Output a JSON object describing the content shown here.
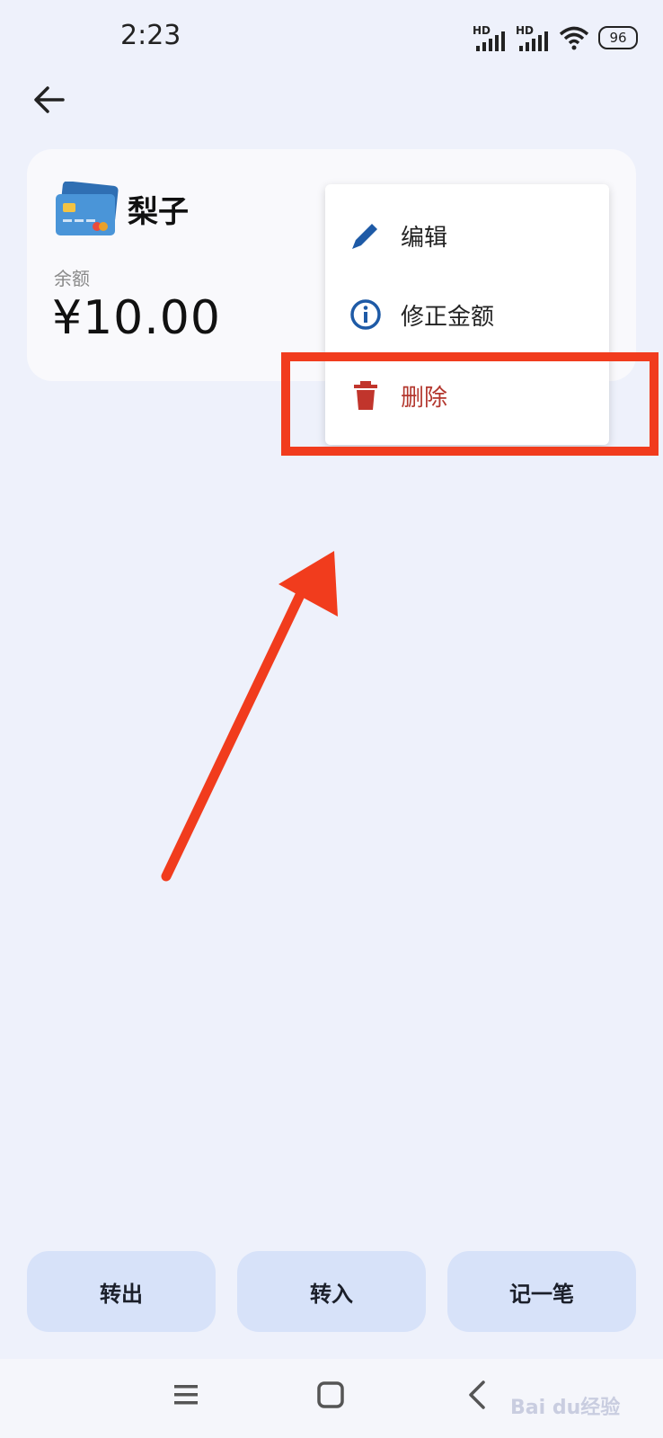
{
  "status_bar": {
    "time": "2:23",
    "signal_1_label": "HD",
    "signal_2_label": "HD",
    "battery": "96"
  },
  "account": {
    "icon": "credit-card-icon",
    "name": "梨子",
    "balance_label": "余额",
    "balance": "¥10.00"
  },
  "menu": {
    "items": [
      {
        "label": "编辑",
        "icon": "pencil-icon",
        "color": "#1e5aa6"
      },
      {
        "label": "修正金额",
        "icon": "info-icon",
        "color": "#1e5aa6"
      },
      {
        "label": "删除",
        "icon": "trash-icon",
        "color": "#c1352c"
      }
    ]
  },
  "actions": [
    {
      "label": "转出"
    },
    {
      "label": "转入"
    },
    {
      "label": "记一笔"
    }
  ],
  "nav": {
    "icons": [
      "menu-icon",
      "home-square-icon",
      "back-chevron-icon"
    ]
  },
  "watermark": {
    "text": "Bai du经验"
  },
  "colors": {
    "background": "#eef1fb",
    "highlight": "#f13c1d",
    "button": "#d7e2f9"
  }
}
